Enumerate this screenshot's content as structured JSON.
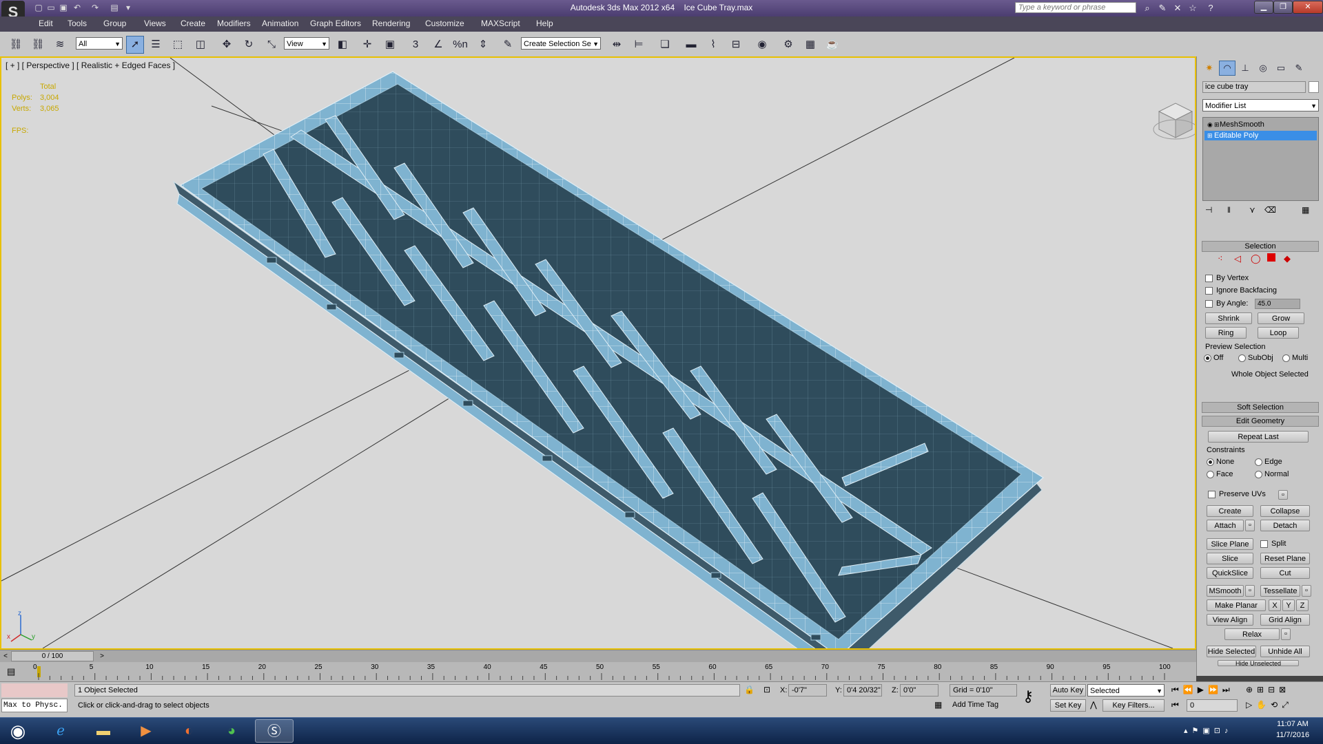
{
  "titlebar": {
    "app_title": "Autodesk 3ds Max  2012 x64",
    "file_name": "Ice Cube Tray.max",
    "search_placeholder": "Type a keyword or phrase",
    "logo_letter": "S"
  },
  "menu": [
    "Edit",
    "Tools",
    "Group",
    "Views",
    "Create",
    "Modifiers",
    "Animation",
    "Graph Editors",
    "Rendering",
    "Customize",
    "MAXScript",
    "Help"
  ],
  "toolbar": {
    "selection_filter": "All",
    "reference_coord": "View",
    "named_selection": "Create Selection Se",
    "snap_3": "3",
    "snap_percent": "%n"
  },
  "viewport": {
    "label": "[ + ] [ Perspective ] [ Realistic + Edged Faces ]",
    "stats_total": "Total",
    "polys_label": "Polys:",
    "polys_value": "3,004",
    "verts_label": "Verts:",
    "verts_value": "3,065",
    "fps_label": "FPS:",
    "axis_x": "x",
    "axis_y": "y",
    "axis_z": "z"
  },
  "command_panel": {
    "object_name": "ice cube tray",
    "modifier_list": "Modifier List",
    "stack": [
      "MeshSmooth",
      "Editable Poly"
    ],
    "selection_title": "Selection",
    "by_vertex": "By Vertex",
    "ignore_backfacing": "Ignore Backfacing",
    "by_angle": "By Angle:",
    "by_angle_value": "45.0",
    "shrink": "Shrink",
    "grow": "Grow",
    "ring": "Ring",
    "loop": "Loop",
    "preview_selection": "Preview Selection",
    "off": "Off",
    "subobj": "SubObj",
    "multi": "Multi",
    "whole_object": "Whole Object Selected",
    "soft_selection": "Soft Selection",
    "edit_geometry": "Edit Geometry",
    "repeat_last": "Repeat Last",
    "constraints": "Constraints",
    "none": "None",
    "edge": "Edge",
    "face": "Face",
    "normal": "Normal",
    "preserve_uvs": "Preserve UVs",
    "create": "Create",
    "collapse": "Collapse",
    "attach": "Attach",
    "detach": "Detach",
    "slice_plane": "Slice Plane",
    "split": "Split",
    "slice": "Slice",
    "reset_plane": "Reset Plane",
    "quickslice": "QuickSlice",
    "cut": "Cut",
    "msmooth": "MSmooth",
    "tessellate": "Tessellate",
    "make_planar": "Make Planar",
    "x": "X",
    "y": "Y",
    "z": "Z",
    "view_align": "View Align",
    "grid_align": "Grid Align",
    "relax": "Relax",
    "hide_selected": "Hide Selected",
    "unhide_all": "Unhide All",
    "hide_unselected": "Hide Unselected"
  },
  "timeline": {
    "frame_counter": "0 / 100",
    "prev": "<",
    "next": ">",
    "ticks": [
      "0",
      "5",
      "10",
      "15",
      "20",
      "25",
      "30",
      "35",
      "40",
      "45",
      "50",
      "55",
      "60",
      "65",
      "70",
      "75",
      "80",
      "85",
      "90",
      "95",
      "100"
    ]
  },
  "statusbar": {
    "maxscript": "Max to Physc.",
    "selection_status": "1 Object Selected",
    "prompt": "Click or click-and-drag to select objects",
    "x_label": "X:",
    "x_value": "-0'7\"",
    "y_label": "Y:",
    "y_value": "0'4 20/32\"",
    "z_label": "Z:",
    "z_value": "0'0\"",
    "grid": "Grid = 0'10\"",
    "add_time_tag": "Add Time Tag",
    "auto_key": "Auto Key",
    "set_key": "Set Key",
    "key_mode": "Selected",
    "key_filters": "Key Filters...",
    "frame": "0"
  },
  "taskbar": {
    "time": "11:07 AM",
    "date": "11/7/2016"
  },
  "colors": {
    "viewport_bg": "#d8d8d8",
    "mesh": "#7fb3d0",
    "mesh_dark": "#2f4c5c",
    "active_border": "#e8c000",
    "selected_stack": "#3a8ee6"
  }
}
